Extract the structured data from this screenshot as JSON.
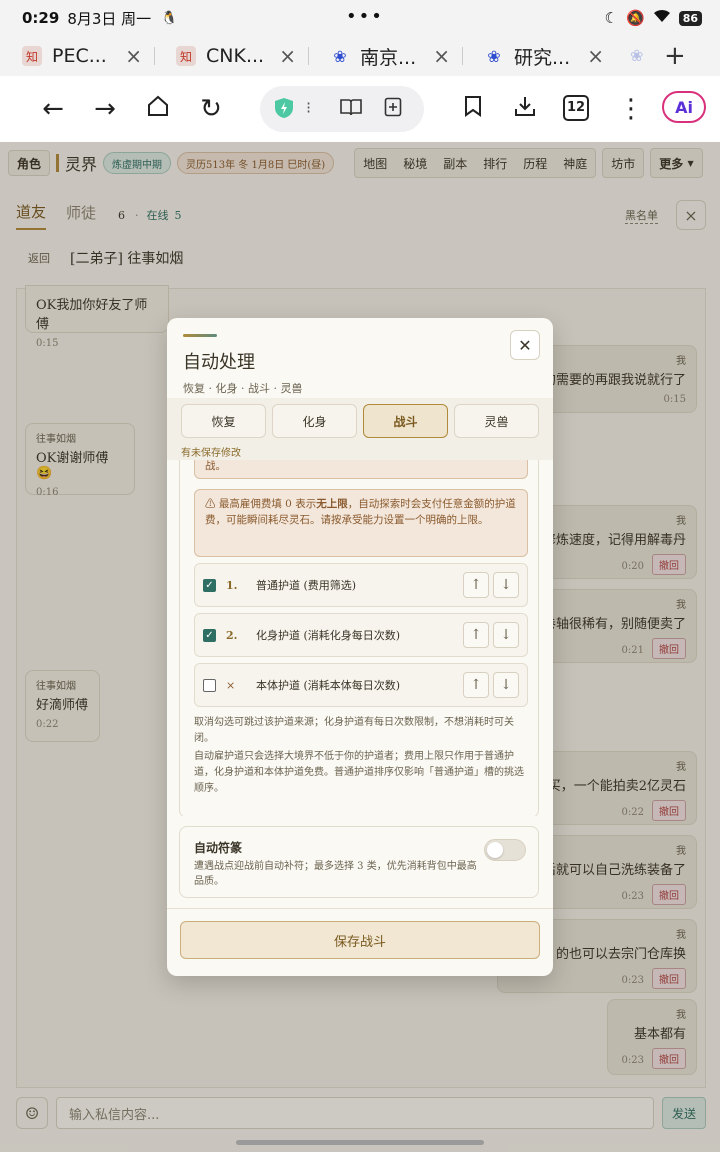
{
  "status": {
    "time": "0:29",
    "date": "8月3日 周一",
    "dots": "•••",
    "battery": "86"
  },
  "browser_tabs": [
    {
      "title": "PEC...",
      "fav_color": "#c0392b"
    },
    {
      "title": "CNK...",
      "fav_color": "#c0392b"
    },
    {
      "title": "南京...",
      "fav_color": "#2f4fd0"
    },
    {
      "title": "研究...",
      "fav_color": "#2f4fd0"
    }
  ],
  "toolbar": {
    "tabs_count": "12",
    "ai": "Ai"
  },
  "nav": {
    "role": "角色",
    "realm": "灵界",
    "stage": "炼虚期中期",
    "calendar": "灵历513年 冬 1月8日 巳时(昼)",
    "links": [
      "地图",
      "秘境",
      "副本",
      "排行",
      "历程",
      "神庭"
    ],
    "market": "坊市",
    "more": "更多"
  },
  "friends": {
    "tab_friends": "道友",
    "tab_master": "师徒",
    "count": "6",
    "online_label": "在线",
    "online": "5",
    "blacklist": "黑名单"
  },
  "chat": {
    "back": "返回",
    "title": "[二弟子] 往事如烟",
    "messages": [
      {
        "from": "",
        "text": "OK我加你好友了师傅",
        "time": "0:15"
      },
      {
        "from": "往事如烟",
        "text": "OK谢谢师傅😆",
        "time": "0:16"
      },
      {
        "from": "往事如烟",
        "text": "好滴师傅",
        "time": "0:22"
      }
    ],
    "mine": [
      {
        "from": "我",
        "text": "的需要的再跟我说就行了",
        "time": "0:15",
        "recall": ""
      },
      {
        "from": "我",
        "text": "修炼速度，记得用解毒丹",
        "time": "0:20",
        "recall": "撤回"
      },
      {
        "from": "我",
        "text": "卷轴很稀有，别随便卖了",
        "time": "0:21",
        "recall": "撤回"
      },
      {
        "from": "我",
        "text": "买，一个能拍卖2亿灵石",
        "time": "0:22",
        "recall": "撤回"
      },
      {
        "from": "我",
        "text": "后就可以自己洗练装备了",
        "time": "0:23",
        "recall": "撤回"
      },
      {
        "from": "我",
        "text": "的也可以去宗门仓库换",
        "time": "0:23",
        "recall": "撤回"
      },
      {
        "from": "我",
        "text": "基本都有",
        "time": "0:23",
        "recall": "撤回"
      }
    ],
    "placeholder": "输入私信内容...",
    "send": "发送"
  },
  "modal": {
    "title": "自动处理",
    "subtitle": "恢复 · 化身 · 战斗 · 灵兽",
    "tabs": [
      "恢复",
      "化身",
      "战斗",
      "灵兽"
    ],
    "unsaved": "有未保存修改",
    "warn_top": "战。",
    "warn_main_a": "⚠ 最高雇佣费填 0 表示",
    "warn_main_bold": "无上限",
    "warn_main_b": "，自动探索时会支付任意金额的护道费，可能瞬间耗尽灵石。请按承受能力设置一个明确的上限。",
    "protectors": [
      {
        "num": "1.",
        "name": "普通护道 (费用筛选)",
        "checked": true
      },
      {
        "num": "2.",
        "name": "化身护道 (消耗化身每日次数)",
        "checked": true
      },
      {
        "num": "×",
        "name": "本体护道 (消耗本体每日次数)",
        "checked": false
      }
    ],
    "note1": "取消勾选可跳过该护道来源；化身护道有每日次数限制，不想消耗时可关闭。",
    "note2": "自动雇护道只会选择大境界不低于你的护道者；费用上限只作用于普通护道，化身护道和本体护道免费。普通护道排序仅影响「普通护道」槽的挑选顺序。",
    "auto_title": "自动符篆",
    "auto_desc": "遭遇战点迎战前自动补符；最多选择 3 类，优先消耗背包中最高品质。",
    "auto_on": false,
    "save": "保存战斗"
  }
}
